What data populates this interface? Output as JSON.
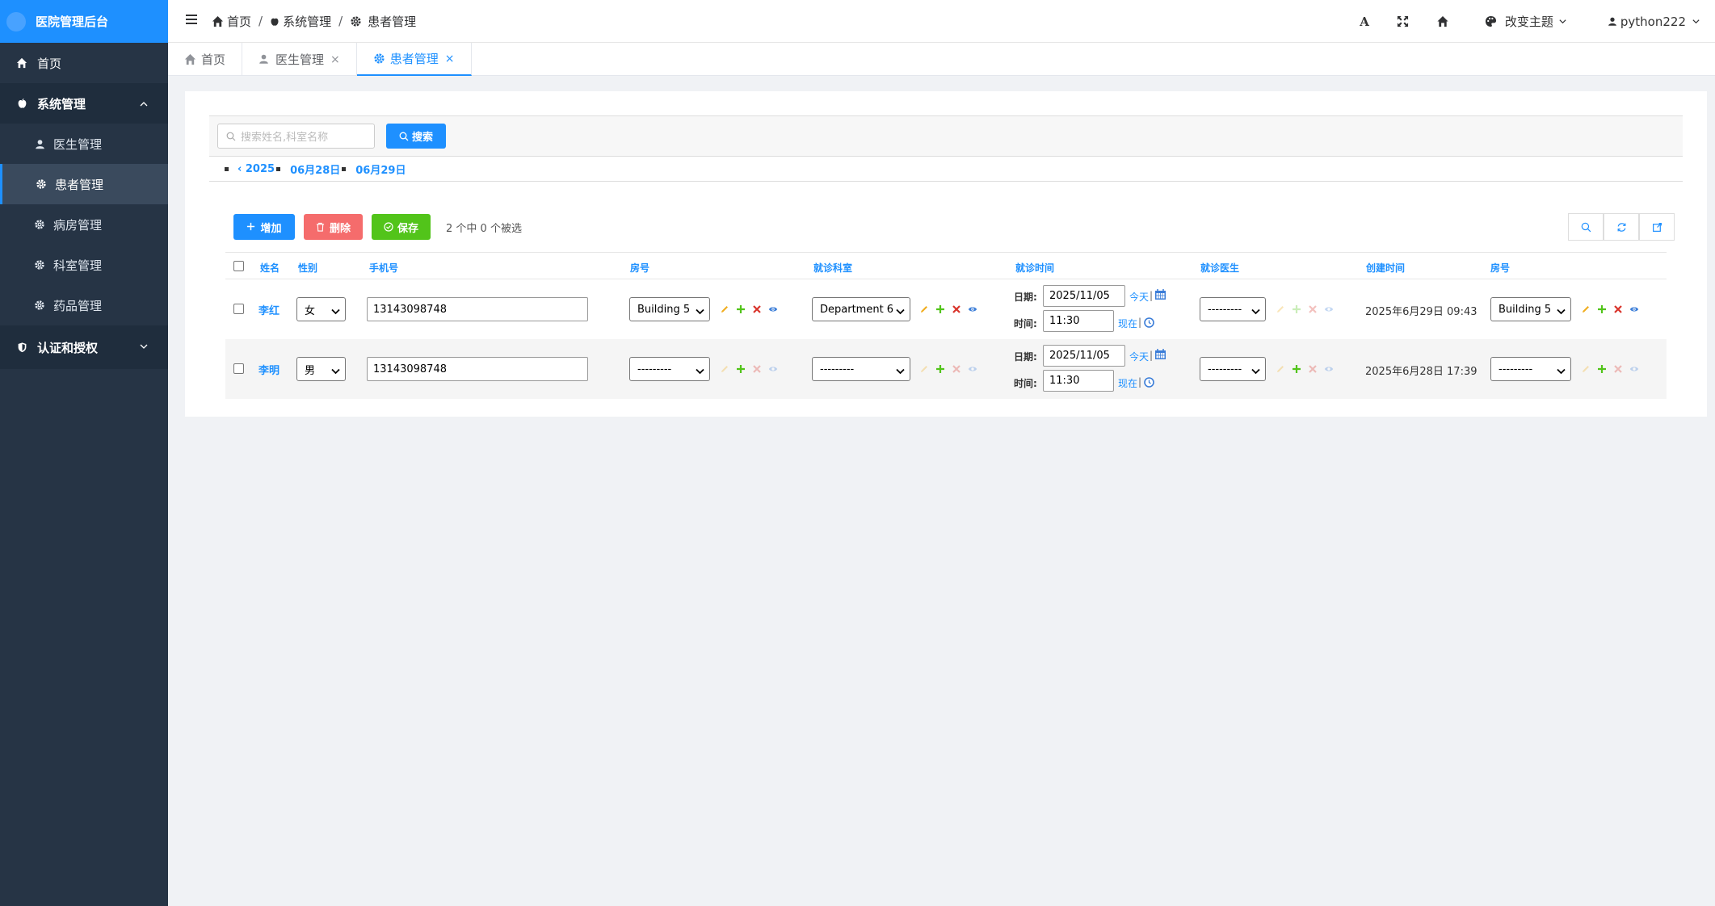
{
  "app_title": "医院管理后台",
  "sidebar": {
    "home": "首页",
    "system": "系统管理",
    "items": [
      "医生管理",
      "患者管理",
      "病房管理",
      "科室管理",
      "药品管理"
    ],
    "auth": "认证和授权"
  },
  "breadcrumb": [
    "首页",
    "系统管理",
    "患者管理"
  ],
  "topbar": {
    "theme": "改变主题",
    "user": "python222"
  },
  "tabs": [
    "首页",
    "医生管理",
    "患者管理"
  ],
  "search": {
    "placeholder": "搜索姓名,科室名称",
    "button": "搜索"
  },
  "datenav": {
    "year": "‹ 2025",
    "d1": "06月28日",
    "d2": "06月29日"
  },
  "actions": {
    "add": "增加",
    "delete": "删除",
    "save": "保存",
    "selected": "2 个中 0 个被选"
  },
  "columns": [
    "姓名",
    "性别",
    "手机号",
    "房号",
    "就诊科室",
    "就诊时间",
    "就诊医生",
    "创建时间",
    "房号"
  ],
  "labels": {
    "date": "日期:",
    "time": "时间:",
    "today": "今天",
    "now": "现在",
    "pipe": "|"
  },
  "rows": [
    {
      "name": "李红",
      "gender": "女",
      "phone": "13143098748",
      "room": "Building 5",
      "dept": "Department 6",
      "date": "2025/11/05",
      "time": "11:30",
      "doctor": "---------",
      "created": "2025年6月29日 09:43",
      "room2": "Building 5"
    },
    {
      "name": "李明",
      "gender": "男",
      "phone": "13143098748",
      "room": "---------",
      "dept": "---------",
      "date": "2025/11/05",
      "time": "11:30",
      "doctor": "---------",
      "created": "2025年6月28日 17:39",
      "room2": "---------"
    }
  ],
  "colors": {
    "primary": "#1e90ff",
    "sidebar": "#263445",
    "danger": "#f56c6c",
    "success": "#52c41a",
    "edit": "#f0ad1e",
    "add": "#52c41a",
    "remove": "#d9342b",
    "view": "#3b7dd8"
  }
}
